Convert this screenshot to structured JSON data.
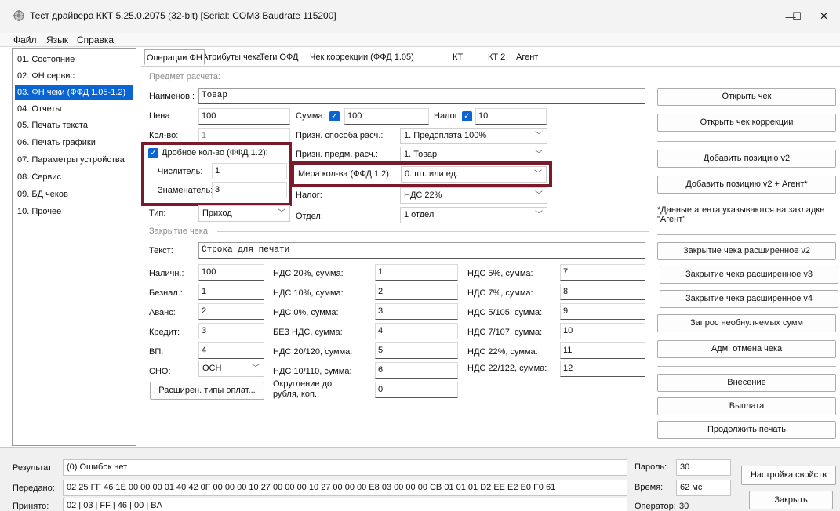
{
  "window": {
    "title": "Тест драйвера ККТ 5.25.0.2075 (32-bit) [Serial: COM3 Baudrate 115200]",
    "minimize": "—",
    "maximize": "☐",
    "close": "✕"
  },
  "menu": [
    "Файл",
    "Язык",
    "Справка"
  ],
  "sidebar": {
    "items": [
      "01. Состояние",
      "02. ФН сервис",
      "03. ФН чеки (ФФД 1.05-1.2)",
      "04. Отчеты",
      "05. Печать текста",
      "06. Печать графики",
      "07. Параметры устройства",
      "08. Сервис",
      "09. БД чеков",
      "10. Прочее"
    ],
    "selected_index": 2
  },
  "tabs": [
    "Операции ФН",
    "Атрибуты чека",
    "Теги ОФД",
    "Чек коррекции (ФФД 1.05)",
    "КТ",
    "КТ 2",
    "Агент"
  ],
  "subject": {
    "group_label": "Предмет расчета:",
    "name_label": "Наименов.:",
    "name_value": "Товар",
    "price_label": "Цена:",
    "price_value": "100",
    "qty_label": "Кол-во:",
    "qty_value": "1",
    "sum_label": "Сумма:",
    "sum_checked": true,
    "sum_value": "100",
    "tax_label": "Налог:",
    "tax_checked": true,
    "tax_value": "10",
    "pay_method_label": "Призн. способа расч.:",
    "pay_method_value": "1. Предоплата 100%",
    "item_kind_label": "Призн. предм. расч.:",
    "item_kind_value": "1. Товар",
    "measure_label": "Мера кол-ва (ФФД 1.2):",
    "measure_value": "0. шт. или ед.",
    "tax2_label": "Налог:",
    "tax2_value": "НДС 22%",
    "dept_label": "Отдел:",
    "dept_value": "1 отдел",
    "fraction_label": "Дробное кол-во (ФФД 1.2):",
    "fraction_checked": true,
    "numerator_label": "Числитель:",
    "numerator_value": "1",
    "denominator_label": "Знаменатель:",
    "denominator_value": "3",
    "type_label": "Тип:",
    "type_value": "Приход"
  },
  "closing": {
    "group_label": "Закрытие чека:",
    "text_label": "Текст:",
    "text_value": "Строка для печати",
    "cash_label": "Наличн.:",
    "cash_value": "100",
    "cashless_label": "Безнал.:",
    "cashless_value": "1",
    "advance_label": "Аванс:",
    "advance_value": "2",
    "credit_label": "Кредит:",
    "credit_value": "3",
    "vp_label": "ВП:",
    "vp_value": "4",
    "sno_label": "СНО:",
    "sno_value": "ОСН",
    "ext_pay_button": "Расширен. типы оплат...",
    "vat": [
      {
        "label": "НДС 20%, сумма:",
        "value": "1"
      },
      {
        "label": "НДС 10%, сумма:",
        "value": "2"
      },
      {
        "label": "НДС 0%, сумма:",
        "value": "3"
      },
      {
        "label": "БЕЗ НДС, сумма:",
        "value": "4"
      },
      {
        "label": "НДС 20/120, сумма:",
        "value": "5"
      },
      {
        "label": "НДС 10/110, сумма:",
        "value": "6"
      },
      {
        "label": "НДС 5%, сумма:",
        "value": "7"
      },
      {
        "label": "НДС 7%, сумма:",
        "value": "8"
      },
      {
        "label": "НДС 5/105, сумма:",
        "value": "9"
      },
      {
        "label": "НДС 7/107, сумма:",
        "value": "10"
      },
      {
        "label": "НДС 22%, сумма:",
        "value": "11"
      },
      {
        "label": "НДС 22/122, сумма:",
        "value": "12"
      }
    ],
    "rounding_label_1": "Округление до",
    "rounding_label_2": "рубля, коп.:",
    "rounding_value": "0"
  },
  "actions": {
    "open_check": "Открыть чек",
    "open_correction": "Открыть чек коррекции",
    "add_item_v2": "Добавить позицию v2",
    "add_item_v2_agent": "Добавить позицию v2 + Агент*",
    "agent_note_1": "*Данные агента указываются на закладке",
    "agent_note_2": "\"Агент\"",
    "close_ext_v2": "Закрытие чека расширенное v2",
    "close_ext_v3": "Закрытие чека расширенное v3",
    "close_ext_v4": "Закрытие чека расширенное v4",
    "request_sums": "Запрос необнуляемых сумм",
    "admin_cancel": "Адм. отмена чека",
    "deposit": "Внесение",
    "payout": "Выплата",
    "continue_print": "Продолжить печать"
  },
  "status": {
    "result_label": "Результат:",
    "result_value": "(0) Ошибок нет",
    "sent_label": "Передано:",
    "sent_value": "02 25 FF 46 1E 00 00 00 01 40 42 0F 00 00 00 10 27 00 00 00 10 27 00 00 00 E8 03 00 00 00 CB 01 01 01 D2 EE E2 E0 F0 61",
    "received_label": "Принято:",
    "received_value": "02 | 03 | FF | 46 | 00 | BA",
    "password_label": "Пароль:",
    "password_value": "30",
    "time_label": "Время:",
    "time_value": "62 мс",
    "operator_label": "Оператор:",
    "operator_value": "30",
    "settings_button": "Настройка свойств",
    "close_button": "Закрыть"
  },
  "colors": {
    "accent": "#0a64d2",
    "highlight_box": "#7a1a2a"
  }
}
